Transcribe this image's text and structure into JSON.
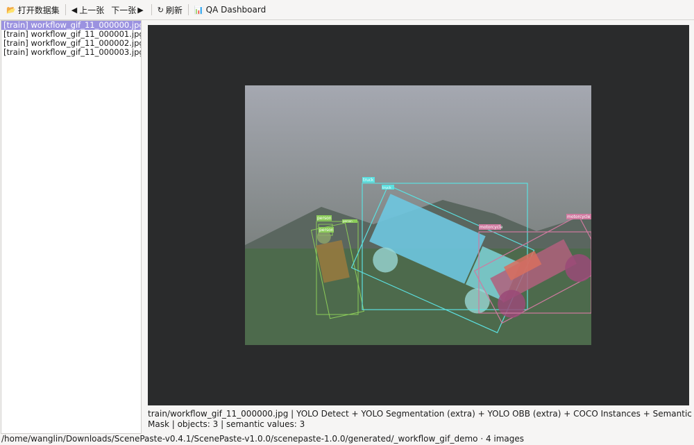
{
  "toolbar": {
    "open_icon": "folder-open-icon",
    "open_label": "打开数据集",
    "prev_icon": "triangle-left-icon",
    "prev_label": "上一张",
    "next_label": "下一张",
    "next_icon": "triangle-right-icon",
    "refresh_icon": "refresh-icon",
    "refresh_label": "刷新",
    "qa_icon": "bar-chart-icon",
    "qa_label": "QA Dashboard"
  },
  "files": [
    {
      "label": "[train] workflow_gif_11_000000.jpg",
      "selected": true
    },
    {
      "label": "[train] workflow_gif_11_000001.jpg",
      "selected": false
    },
    {
      "label": "[train] workflow_gif_11_000002.jpg",
      "selected": false
    },
    {
      "label": "[train] workflow_gif_11_000003.jpg",
      "selected": false
    }
  ],
  "annotations": {
    "labels": [
      "truck",
      "truck",
      "person",
      "person",
      "person",
      "motorcycle",
      "motorcycle"
    ]
  },
  "colors": {
    "truck": "#5ce0e0",
    "person": "#8ccc5a",
    "motorcycle": "#d07aa0",
    "selection": "#9b92e0",
    "viewer_bg": "#2a2b2c"
  },
  "info_text": "train/workflow_gif_11_000000.jpg  |  YOLO Detect + YOLO Segmentation (extra) + YOLO OBB (extra) + COCO Instances + Semantic Mask  |  objects: 3  |  semantic values: 3",
  "status_text": "/home/wanglin/Downloads/ScenePaste-v0.4.1/ScenePaste-v1.0.0/scenepaste-1.0.0/generated/_workflow_gif_demo · 4 images"
}
